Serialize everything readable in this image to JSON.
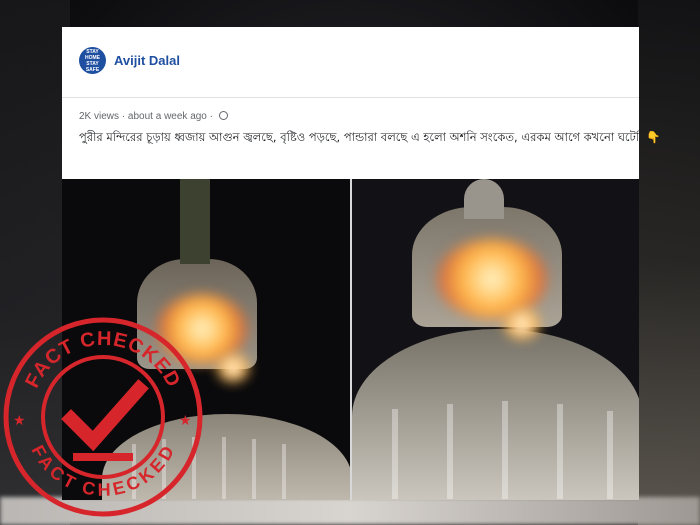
{
  "post": {
    "author_name": "Avijit Dalal",
    "avatar_text": "STAY HOME STAY SAFE",
    "views": "2K views",
    "separator": "·",
    "time": "about a week ago",
    "separator2": "·",
    "caption": "পুরীর মন্দিরের চূড়ায় ধ্বজায় আগুন জ্বলছে, বৃষ্টিও পড়ছে, পান্ডারা বলছে এ হলো অশনি সংকেত, এরকম আগে কখনো ঘটেনি👇"
  },
  "stamp": {
    "top_text": "FACT CHECKED",
    "bottom_text": "FACT CHECKED",
    "color": "#d7262b"
  },
  "colors": {
    "brand_blue": "#1f4fa0",
    "flame": "#ffb347"
  }
}
